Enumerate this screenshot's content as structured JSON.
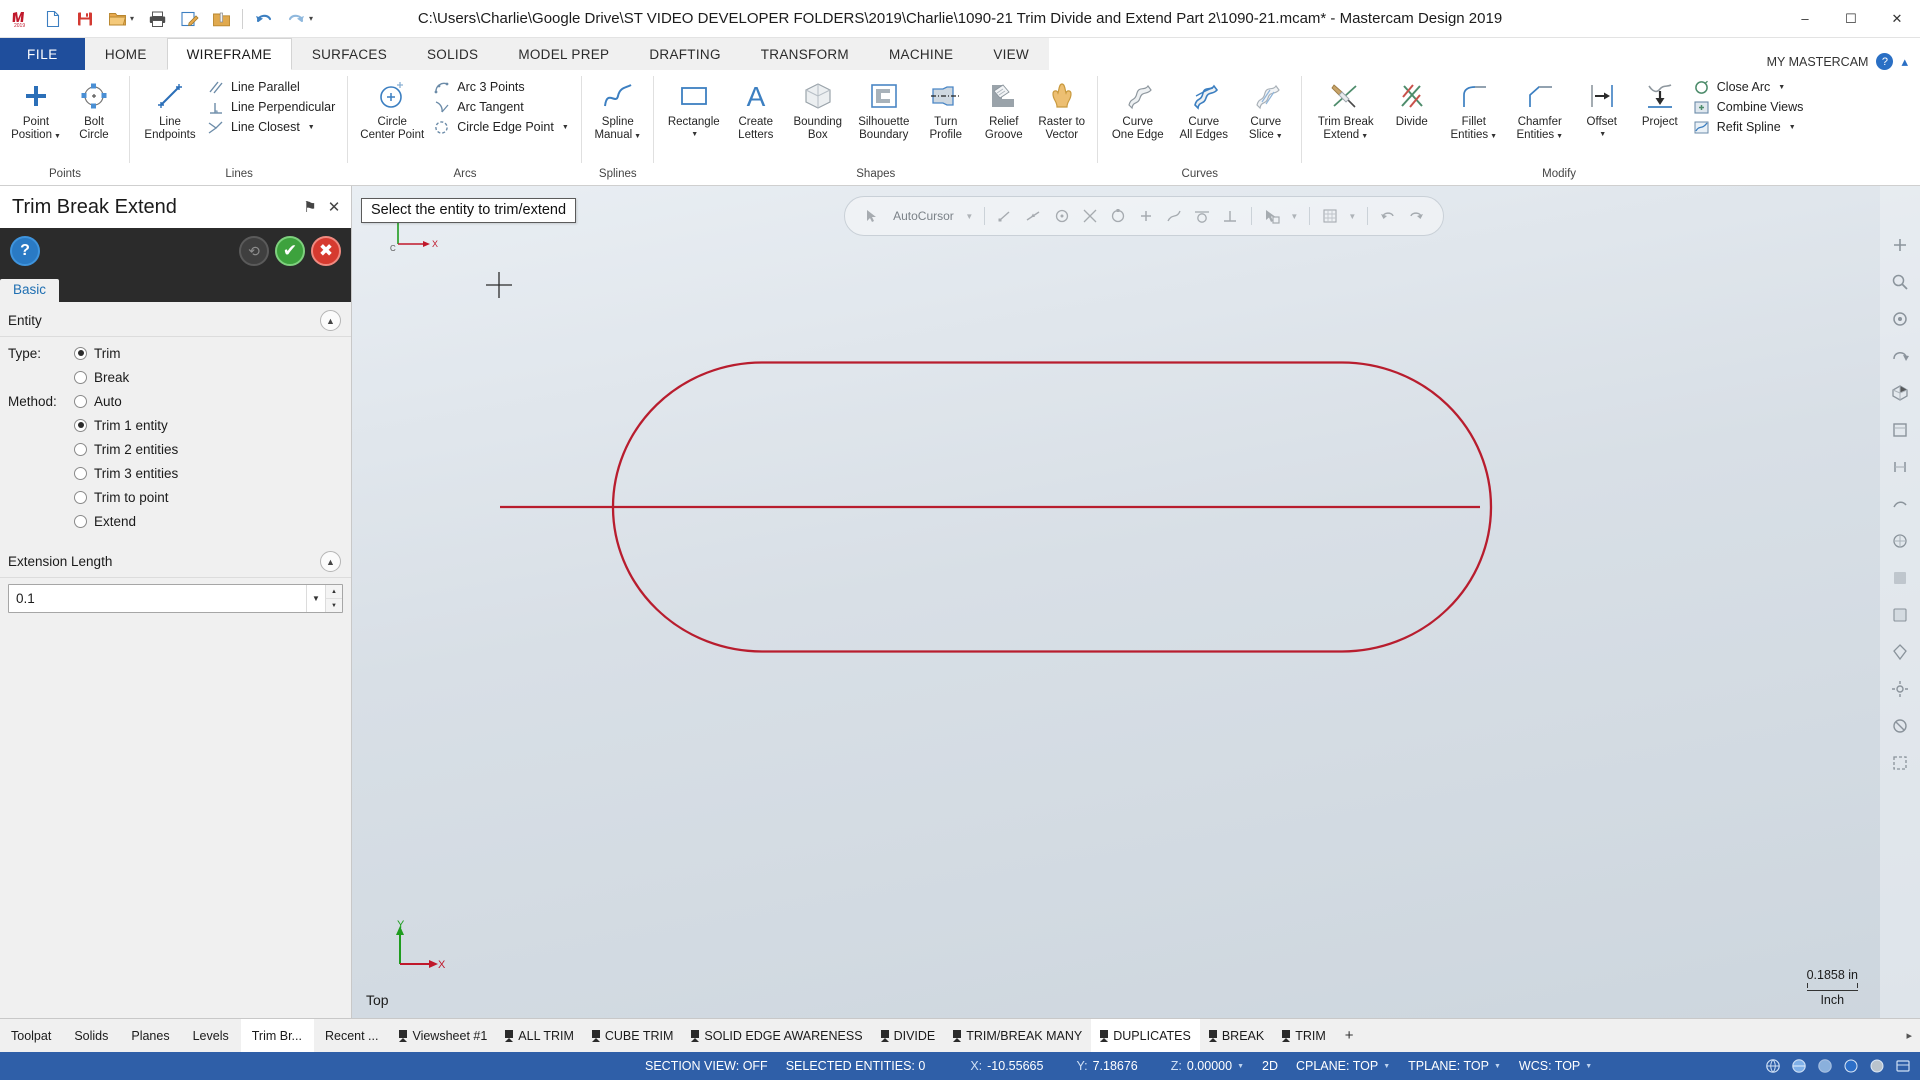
{
  "titlebar": {
    "title": "C:\\Users\\Charlie\\Google Drive\\ST VIDEO DEVELOPER FOLDERS\\2019\\Charlie\\1090-21 Trim Divide and Extend Part 2\\1090-21.mcam* - Mastercam Design 2019",
    "quick_access": [
      {
        "name": "mastercam-logo-icon",
        "label": "Mastercam"
      },
      {
        "name": "new-file-icon",
        "label": "New"
      },
      {
        "name": "save-icon",
        "label": "Save"
      },
      {
        "name": "open-folder-icon",
        "label": "Open"
      },
      {
        "name": "print-icon",
        "label": "Print"
      },
      {
        "name": "print-preview-icon",
        "label": "Print Preview"
      },
      {
        "name": "zip2go-icon",
        "label": "Zip2Go"
      },
      {
        "name": "undo-icon",
        "label": "Undo"
      },
      {
        "name": "redo-icon",
        "label": "Redo"
      },
      {
        "name": "customize-qat-icon",
        "label": "Customize Quick Access Toolbar"
      }
    ],
    "window_controls": {
      "minimize": "–",
      "maximize": "☐",
      "close": "✕"
    }
  },
  "ribbon": {
    "tabs": [
      {
        "label": "FILE",
        "kind": "file"
      },
      {
        "label": "HOME",
        "kind": "normal"
      },
      {
        "label": "WIREFRAME",
        "kind": "active"
      },
      {
        "label": "SURFACES",
        "kind": "normal"
      },
      {
        "label": "SOLIDS",
        "kind": "normal"
      },
      {
        "label": "MODEL PREP",
        "kind": "normal"
      },
      {
        "label": "DRAFTING",
        "kind": "normal"
      },
      {
        "label": "TRANSFORM",
        "kind": "normal"
      },
      {
        "label": "MACHINE",
        "kind": "normal"
      },
      {
        "label": "VIEW",
        "kind": "normal"
      }
    ],
    "right": {
      "account_label": "MY MASTERCAM",
      "help_label": "?",
      "expand_label": "⌃"
    },
    "groups": [
      {
        "title": "Points",
        "big": [
          {
            "label_line1": "Point",
            "label_line2": "Position",
            "icon": "point-position-icon",
            "dropdown": true
          },
          {
            "label_line1": "Bolt",
            "label_line2": "Circle",
            "icon": "bolt-circle-icon",
            "dropdown": false
          }
        ],
        "small": []
      },
      {
        "title": "Lines",
        "big": [
          {
            "label_line1": "Line",
            "label_line2": "Endpoints",
            "icon": "line-endpoints-icon",
            "dropdown": false
          }
        ],
        "small": [
          {
            "label": "Line Parallel",
            "icon": "line-parallel-icon",
            "dropdown": false
          },
          {
            "label": "Line Perpendicular",
            "icon": "line-perpendicular-icon",
            "dropdown": false
          },
          {
            "label": "Line Closest",
            "icon": "line-closest-icon",
            "dropdown": true
          }
        ]
      },
      {
        "title": "Arcs",
        "big": [
          {
            "label_line1": "Circle",
            "label_line2": "Center Point",
            "icon": "circle-center-point-icon",
            "dropdown": false
          }
        ],
        "small": [
          {
            "label": "Arc 3 Points",
            "icon": "arc-3-points-icon",
            "dropdown": false
          },
          {
            "label": "Arc Tangent",
            "icon": "arc-tangent-icon",
            "dropdown": false
          },
          {
            "label": "Circle Edge Point",
            "icon": "circle-edge-point-icon",
            "dropdown": true
          }
        ]
      },
      {
        "title": "Splines",
        "big": [
          {
            "label_line1": "Spline",
            "label_line2": "Manual",
            "icon": "spline-manual-icon",
            "dropdown": true
          }
        ],
        "small": []
      },
      {
        "title": "Shapes",
        "big": [
          {
            "label_line1": "Rectangle",
            "label_line2": "",
            "icon": "rectangle-icon",
            "dropdown": true
          },
          {
            "label_line1": "Create",
            "label_line2": "Letters",
            "icon": "create-letters-icon",
            "dropdown": false
          },
          {
            "label_line1": "Bounding",
            "label_line2": "Box",
            "icon": "bounding-box-icon",
            "dropdown": false
          },
          {
            "label_line1": "Silhouette",
            "label_line2": "Boundary",
            "icon": "silhouette-boundary-icon",
            "dropdown": false
          },
          {
            "label_line1": "Turn",
            "label_line2": "Profile",
            "icon": "turn-profile-icon",
            "dropdown": false
          },
          {
            "label_line1": "Relief",
            "label_line2": "Groove",
            "icon": "relief-groove-icon",
            "dropdown": false
          },
          {
            "label_line1": "Raster to",
            "label_line2": "Vector",
            "icon": "raster-to-vector-icon",
            "dropdown": false
          }
        ],
        "small": []
      },
      {
        "title": "Curves",
        "big": [
          {
            "label_line1": "Curve",
            "label_line2": "One Edge",
            "icon": "curve-one-edge-icon",
            "dropdown": false
          },
          {
            "label_line1": "Curve",
            "label_line2": "All Edges",
            "icon": "curve-all-edges-icon",
            "dropdown": false
          },
          {
            "label_line1": "Curve",
            "label_line2": "Slice",
            "icon": "curve-slice-icon",
            "dropdown": true
          }
        ],
        "small": []
      },
      {
        "title": "Modify",
        "big": [
          {
            "label_line1": "Trim Break",
            "label_line2": "Extend",
            "icon": "trim-break-extend-icon",
            "dropdown": true
          },
          {
            "label_line1": "Divide",
            "label_line2": "",
            "icon": "divide-icon",
            "dropdown": false
          },
          {
            "label_line1": "Fillet",
            "label_line2": "Entities",
            "icon": "fillet-entities-icon",
            "dropdown": true
          },
          {
            "label_line1": "Chamfer",
            "label_line2": "Entities",
            "icon": "chamfer-entities-icon",
            "dropdown": true
          },
          {
            "label_line1": "Offset",
            "label_line2": "",
            "icon": "offset-icon",
            "dropdown": true
          },
          {
            "label_line1": "Project",
            "label_line2": "",
            "icon": "project-icon",
            "dropdown": false
          }
        ],
        "small": [
          {
            "label": "Close Arc",
            "icon": "close-arc-icon",
            "dropdown": true
          },
          {
            "label": "Combine Views",
            "icon": "combine-views-icon",
            "dropdown": false
          },
          {
            "label": "Refit Spline",
            "icon": "refit-spline-icon",
            "dropdown": true
          }
        ]
      }
    ]
  },
  "panel": {
    "title": "Trim Break Extend",
    "header_buttons": [
      {
        "name": "pin-panel-icon",
        "glyph": "⚑"
      },
      {
        "name": "close-panel-icon",
        "glyph": "✕"
      }
    ],
    "toolbar": [
      {
        "name": "help-button",
        "glyph": "?",
        "style": "help"
      },
      {
        "name": "reapply-button",
        "glyph": "⟲",
        "style": "undo"
      },
      {
        "name": "ok-button",
        "glyph": "✔",
        "style": "ok"
      },
      {
        "name": "cancel-button",
        "glyph": "✖",
        "style": "cancel"
      }
    ],
    "tabs": [
      {
        "label": "Basic",
        "active": true
      }
    ],
    "sections": [
      {
        "title": "Entity",
        "collapsed": false,
        "rows": [
          {
            "label": "Type:",
            "options": [
              {
                "label": "Trim",
                "selected": true
              },
              {
                "label": "Break",
                "selected": false
              }
            ]
          },
          {
            "label": "Method:",
            "options": [
              {
                "label": "Auto",
                "selected": false
              },
              {
                "label": "Trim 1 entity",
                "selected": true
              },
              {
                "label": "Trim 2 entities",
                "selected": false
              },
              {
                "label": "Trim 3 entities",
                "selected": false
              },
              {
                "label": "Trim to point",
                "selected": false
              },
              {
                "label": "Extend",
                "selected": false
              }
            ]
          }
        ]
      }
    ],
    "extension": {
      "title": "Extension Length",
      "value": "0.1",
      "placeholder": ""
    }
  },
  "graphics": {
    "prompt": "Select the entity to trim/extend",
    "view_label": "Top",
    "scale": {
      "value": "0.1858 in",
      "unit": "Inch"
    },
    "axes": {
      "x": "X",
      "y": "Y",
      "origin": "C"
    },
    "float_toolbar": {
      "autocursor_label": "AutoCursor",
      "buttons": [
        {
          "name": "autocursor-icon"
        },
        {
          "name": "autocursor-dropdown-icon"
        },
        {
          "name": "endpoint-snap-icon"
        },
        {
          "name": "midpoint-snap-icon"
        },
        {
          "name": "center-snap-icon"
        },
        {
          "name": "intersection-snap-icon"
        },
        {
          "name": "quadrant-snap-icon"
        },
        {
          "name": "point-snap-icon"
        },
        {
          "name": "nearest-snap-icon"
        },
        {
          "name": "tangent-snap-icon"
        },
        {
          "name": "perpendicular-snap-icon"
        },
        {
          "name": "grid-snap-icon"
        },
        {
          "name": "grid-dropdown-icon"
        },
        {
          "name": "select-all-icon"
        },
        {
          "name": "select-only-icon"
        }
      ]
    },
    "vtoolbar": [
      {
        "name": "fit-screen-icon"
      },
      {
        "name": "zoom-window-icon"
      },
      {
        "name": "zoom-target-icon"
      },
      {
        "name": "dynamic-rotate-icon"
      },
      {
        "name": "unzoom-icon"
      },
      {
        "name": "isometric-view-icon"
      },
      {
        "name": "top-view-icon"
      },
      {
        "name": "front-view-icon"
      },
      {
        "name": "right-view-icon"
      },
      {
        "name": "wireframe-shading-icon"
      },
      {
        "name": "shaded-view-icon"
      },
      {
        "name": "translucent-view-icon"
      },
      {
        "name": "materials-icon"
      },
      {
        "name": "settings-view-icon"
      },
      {
        "name": "hide-entities-icon"
      },
      {
        "name": "blank-entities-icon"
      }
    ],
    "geometry": {
      "description": "Red slot/obround outline with a horizontal red line through the middle extending past both ends",
      "color": "#b81d2e"
    }
  },
  "bottom_tabs": {
    "left": [
      {
        "label": "Toolpat",
        "active": false
      },
      {
        "label": "Solids",
        "active": false
      },
      {
        "label": "Planes",
        "active": false
      },
      {
        "label": "Levels",
        "active": false
      },
      {
        "label": "Trim Br...",
        "active": true
      },
      {
        "label": "Recent ...",
        "active": false
      }
    ],
    "viewsheets": [
      {
        "label": "Viewsheet #1",
        "active": false
      },
      {
        "label": "ALL TRIM",
        "active": false
      },
      {
        "label": "CUBE TRIM",
        "active": false
      },
      {
        "label": "SOLID EDGE AWARENESS",
        "active": false
      },
      {
        "label": "DIVIDE",
        "active": false
      },
      {
        "label": "TRIM/BREAK MANY",
        "active": false
      },
      {
        "label": "DUPLICATES",
        "active": true
      },
      {
        "label": "BREAK",
        "active": false
      },
      {
        "label": "TRIM",
        "active": false
      }
    ],
    "add_label": "+"
  },
  "statusbar": {
    "section_view": "SECTION VIEW: OFF",
    "selected_entities": "SELECTED ENTITIES: 0",
    "coords": [
      {
        "key": "X:",
        "value": "-10.55665"
      },
      {
        "key": "Y:",
        "value": "7.18676"
      },
      {
        "key": "Z:",
        "value": "0.00000"
      }
    ],
    "mode": "2D",
    "cplane": "CPLANE: TOP",
    "tplane": "TPLANE: TOP",
    "wcs": "WCS: TOP",
    "icons": [
      {
        "name": "globe-wireframe-icon"
      },
      {
        "name": "globe-shaded-icon"
      },
      {
        "name": "globe-translucent-icon"
      },
      {
        "name": "color-swatch-blue-icon"
      },
      {
        "name": "color-swatch-gray-icon"
      },
      {
        "name": "level-indicator-icon"
      }
    ]
  },
  "colors": {
    "accent_blue": "#1f4e9c",
    "status_blue": "#2f5fa8",
    "geometry_red": "#b81d2e",
    "panel_dark": "#2b2b2b",
    "ok_green": "#3da23d",
    "cancel_red": "#d63a2f"
  }
}
